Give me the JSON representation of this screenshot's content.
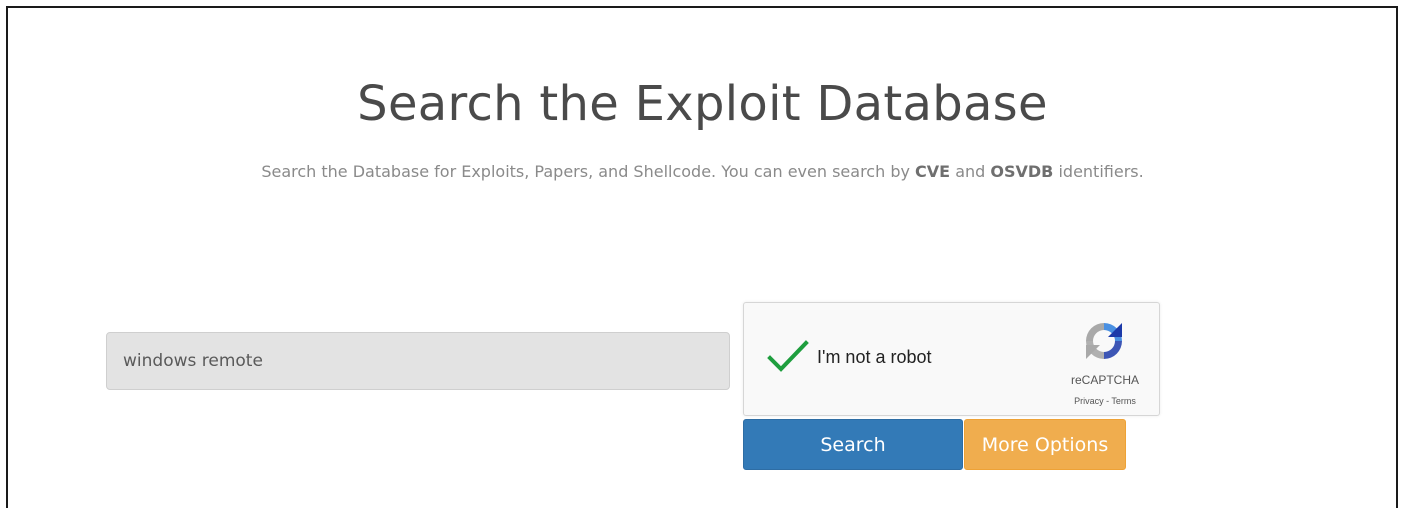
{
  "header": {
    "title": "Search the Exploit Database",
    "subtitle_part1": "Search the Database for Exploits, Papers, and Shellcode. You can even search by ",
    "subtitle_cve": "CVE",
    "subtitle_part2": " and ",
    "subtitle_osvdb": "OSVDB",
    "subtitle_part3": " identifiers."
  },
  "search": {
    "value": "windows remote",
    "placeholder": ""
  },
  "recaptcha": {
    "label": "I'm not a robot",
    "checked": true,
    "brand": "reCAPTCHA",
    "terms": "Privacy - Terms",
    "check_color": "#1e9e3e"
  },
  "buttons": {
    "search_label": "Search",
    "more_options_label": "More Options",
    "search_color": "#337ab7",
    "more_options_color": "#f0ad4e"
  }
}
